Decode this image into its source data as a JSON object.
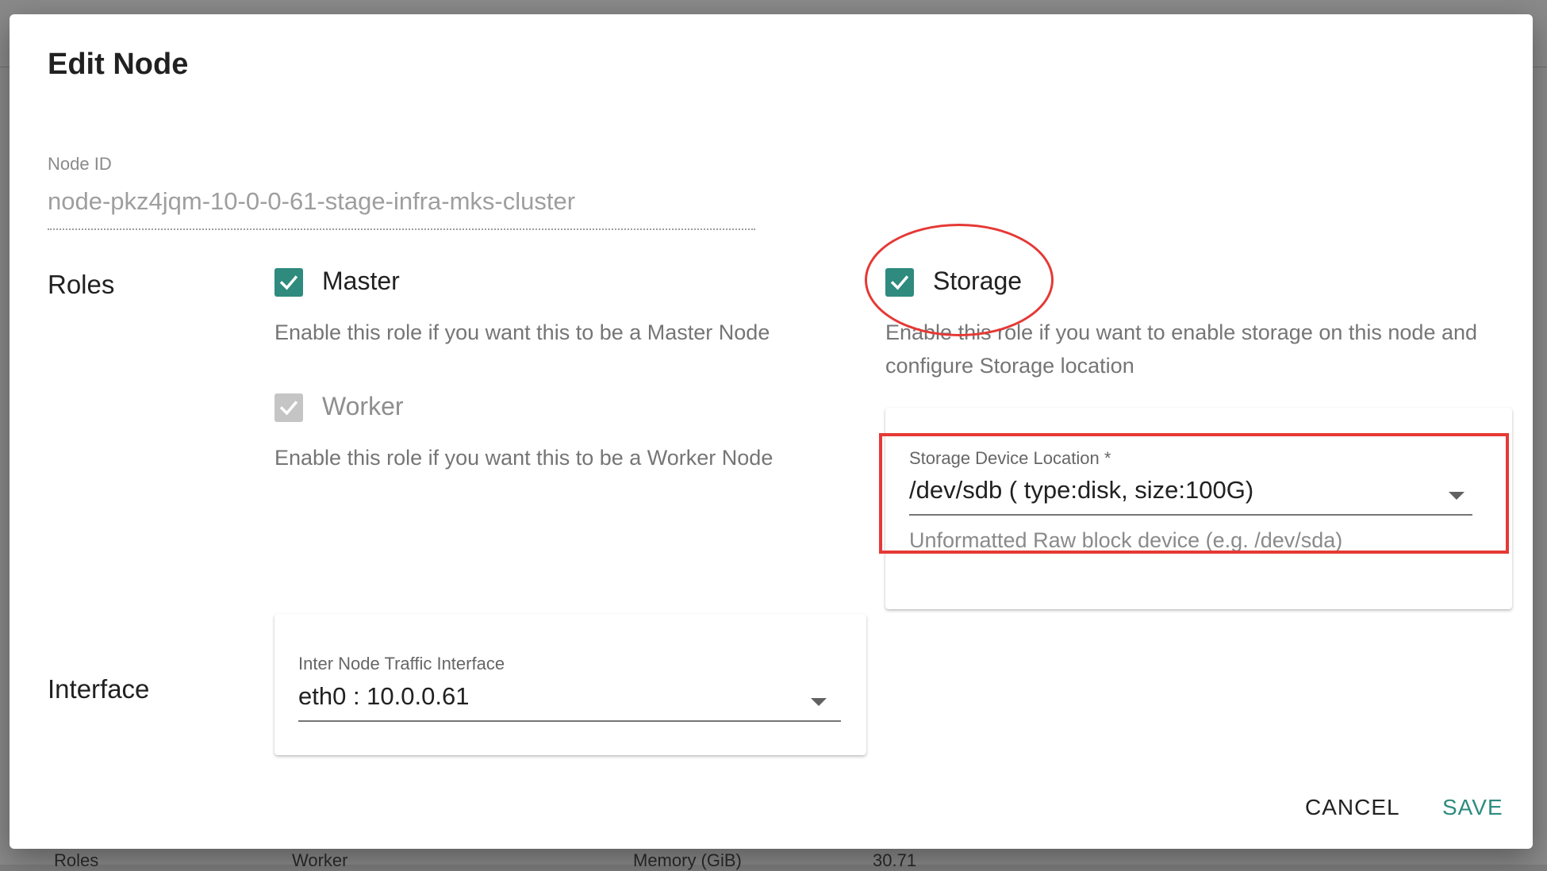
{
  "background": {
    "cells": [
      {
        "name": "bg-cell-roles",
        "text": "Roles"
      },
      {
        "name": "bg-cell-worker",
        "text": "Worker"
      },
      {
        "name": "bg-cell-memory",
        "text": "Memory (GiB)"
      },
      {
        "name": "bg-cell-memory-value",
        "text": "30.71"
      }
    ]
  },
  "dialog": {
    "title": "Edit Node",
    "node_id": {
      "label": "Node ID",
      "value": "node-pkz4jqm-10-0-0-61-stage-infra-mks-cluster"
    },
    "roles": {
      "label": "Roles",
      "master": {
        "label": "Master",
        "checked": true,
        "description": "Enable this role if you want this to be a Master Node"
      },
      "worker": {
        "label": "Worker",
        "checked": true,
        "disabled": true,
        "description": "Enable this role if you want this to be a Worker Node"
      },
      "storage": {
        "label": "Storage",
        "checked": true,
        "description": "Enable this role if you want to enable storage on this node and configure Storage location"
      }
    },
    "storage_device": {
      "label": "Storage Device Location *",
      "value": "/dev/sdb ( type:disk, size:100G)",
      "hint": "Unformatted Raw block device (e.g. /dev/sda)"
    },
    "interface": {
      "label": "Interface",
      "field_label": "Inter Node Traffic Interface",
      "value": "eth0 : 10.0.0.61"
    },
    "buttons": {
      "cancel": "CANCEL",
      "save": "SAVE"
    }
  },
  "colors": {
    "accent": "#2e8b7e",
    "annotation": "#e53935",
    "disabled_checkbox": "#c5c5c5"
  }
}
